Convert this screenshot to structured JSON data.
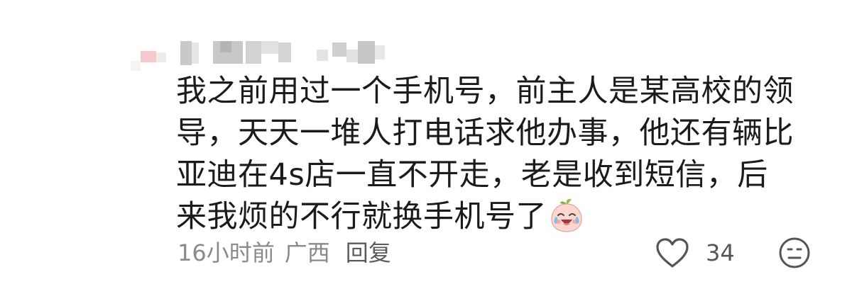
{
  "comment": {
    "text": "我之前用过一个手机号，前主人是某高校的领导，天天一堆人打电话求他办事，他还有辆比亚迪在4s店一直不开走，老是收到短信，后来我烦的不行就换手机号了",
    "emoji_icon": "crying-laughing-peach-emoji-icon"
  },
  "meta": {
    "time": "16小时前",
    "location": "广西",
    "reply_label": "回复"
  },
  "actions": {
    "like_icon": "heart-outline-icon",
    "like_count": "34",
    "dislike_icon": "unhappy-face-icon"
  },
  "colors": {
    "text": "#1b1b1b",
    "meta": "#8a8a8a",
    "icon": "#555555",
    "mosaic_pink": "#f2c8cc"
  }
}
